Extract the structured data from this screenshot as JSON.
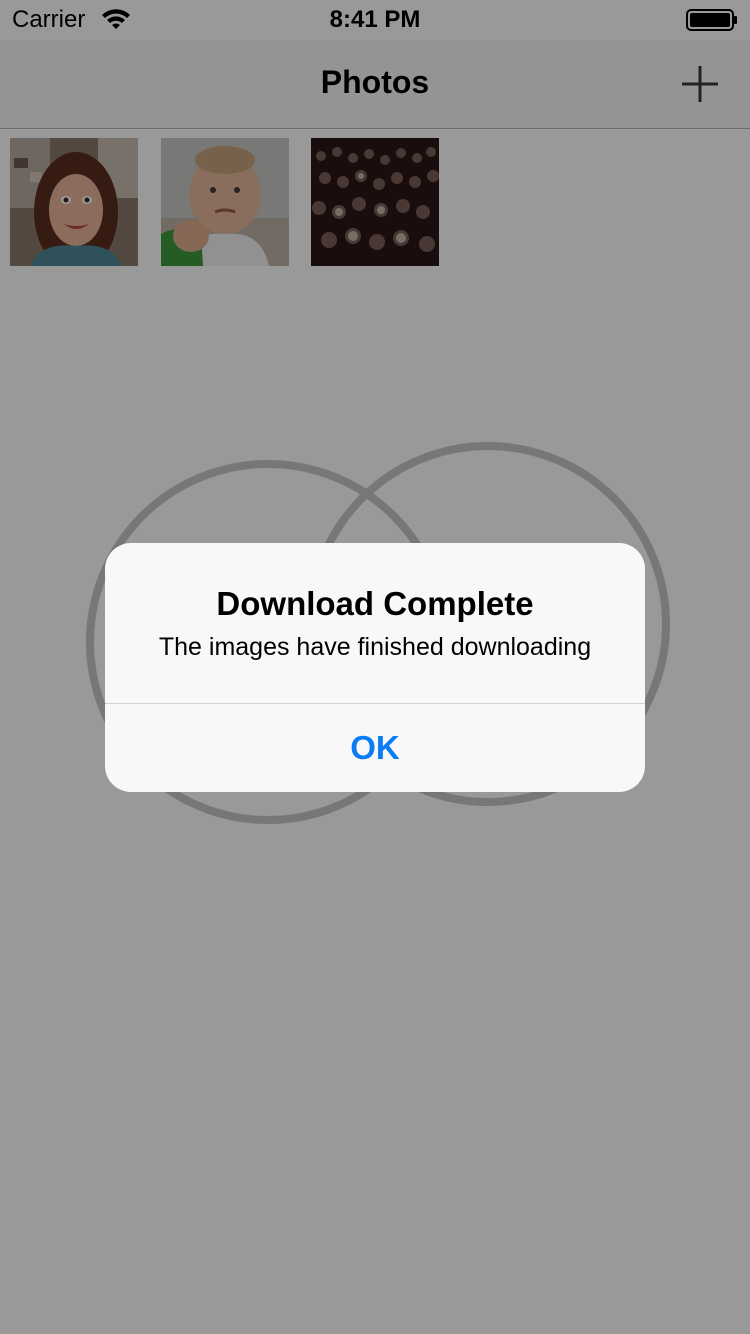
{
  "status_bar": {
    "carrier": "Carrier",
    "time": "8:41 PM",
    "wifi_icon": "wifi-icon",
    "battery_icon": "battery-full-icon"
  },
  "nav_bar": {
    "title": "Photos",
    "add_icon": "plus-icon"
  },
  "photos": [
    {
      "name": "photo-woman"
    },
    {
      "name": "photo-baby-fist"
    },
    {
      "name": "photo-crowd"
    }
  ],
  "alert": {
    "title": "Download Complete",
    "message": "The images have finished downloading",
    "button_label": "OK"
  },
  "colors": {
    "accent": "#0a7cf5",
    "overlay": "rgba(0,0,0,0.40)"
  }
}
